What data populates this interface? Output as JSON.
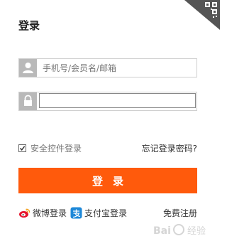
{
  "header": {
    "title": "登录",
    "qr_icon": "qr-code-corner-icon"
  },
  "form": {
    "username": {
      "placeholder": "手机号/会员名/邮箱",
      "value": "",
      "icon": "user-icon"
    },
    "password": {
      "value": "",
      "icon": "lock-icon"
    },
    "remember": {
      "label": "安全控件登录",
      "checked": true
    },
    "forgot_label": "忘记登录密码?",
    "submit_label": "登录"
  },
  "footer": {
    "weibo_label": "微博登录",
    "alipay_label": "支付宝登录",
    "register_label": "免费注册"
  },
  "colors": {
    "accent": "#ff5a0c",
    "icon_bg": "#b9b9b9"
  },
  "watermark": {
    "text": "Bai 经验"
  }
}
